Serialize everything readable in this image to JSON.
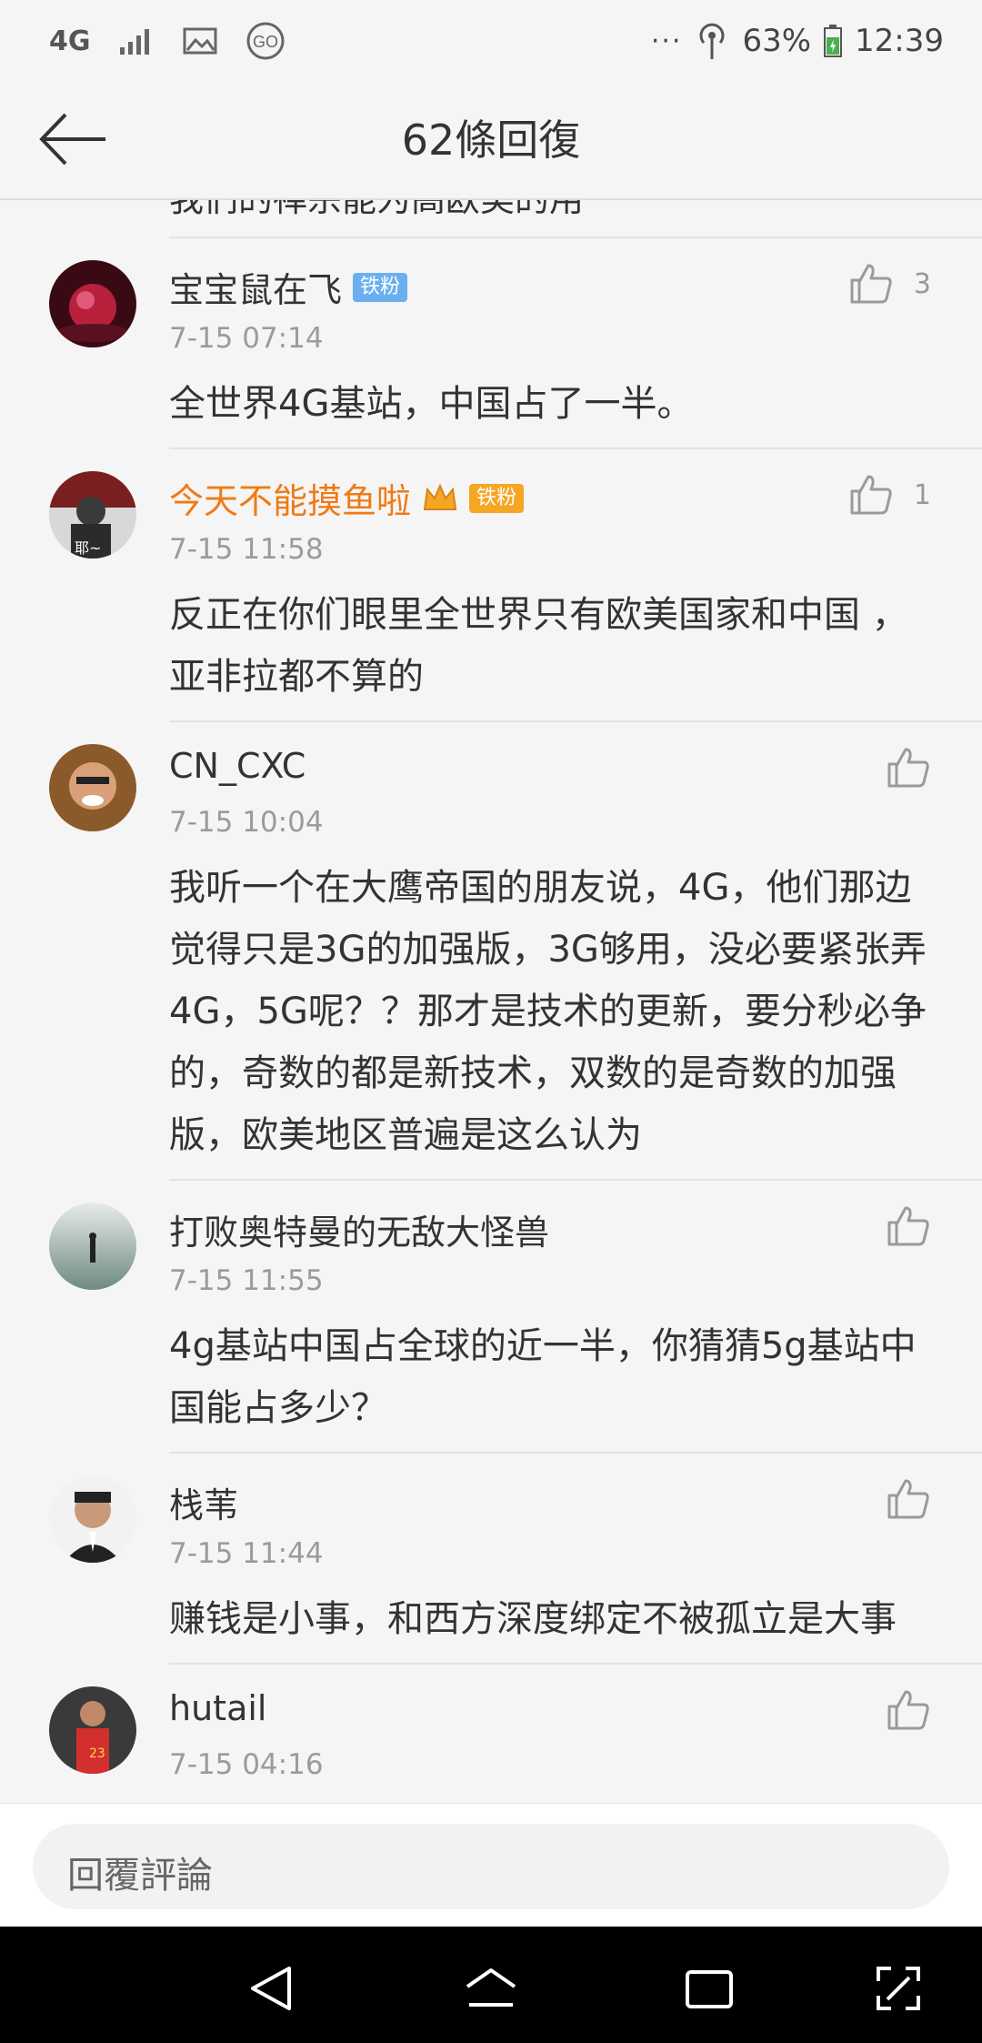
{
  "status_bar": {
    "network": "4G",
    "battery": "63%",
    "time": "12:39"
  },
  "header": {
    "title": "62條回復"
  },
  "clipped_previous_text": "我们的禅宗能为高欧美的用",
  "comments": [
    {
      "name": "宝宝鼠在飞",
      "badge": "铁粉",
      "time": "7-15 07:14",
      "text": "全世界4G基站，中国占了一半。",
      "likes": "3"
    },
    {
      "name": "今天不能摸鱼啦",
      "badge": "铁粉",
      "time": "7-15 11:58",
      "text": "反正在你们眼里全世界只有欧美国家和中国 ，亚非拉都不算的",
      "likes": "1"
    },
    {
      "name": "CN_CXC",
      "time": "7-15 10:04",
      "text": "我听一个在大鹰帝国的朋友说，4G，他们那边觉得只是3G的加强版，3G够用，没必要紧张弄4G，5G呢？？那才是技术的更新，要分秒必争的，奇数的都是新技术，双数的是奇数的加强版，欧美地区普遍是这么认为"
    },
    {
      "name": "打败奥特曼的无敌大怪兽",
      "time": "7-15 11:55",
      "text": "4g基站中国占全球的近一半，你猜猜5g基站中国能占多少？"
    },
    {
      "name": "栈苇",
      "time": "7-15 11:44",
      "text": "赚钱是小事，和西方深度绑定不被孤立是大事"
    },
    {
      "name": "hutail",
      "time": "7-15 04:16",
      "text": ""
    }
  ],
  "reply_bar": {
    "placeholder": "回覆評論"
  },
  "colors": {
    "vip_name": "#f07a15",
    "badge_blue": "#6ab0f0",
    "badge_gold": "#f5a623"
  }
}
